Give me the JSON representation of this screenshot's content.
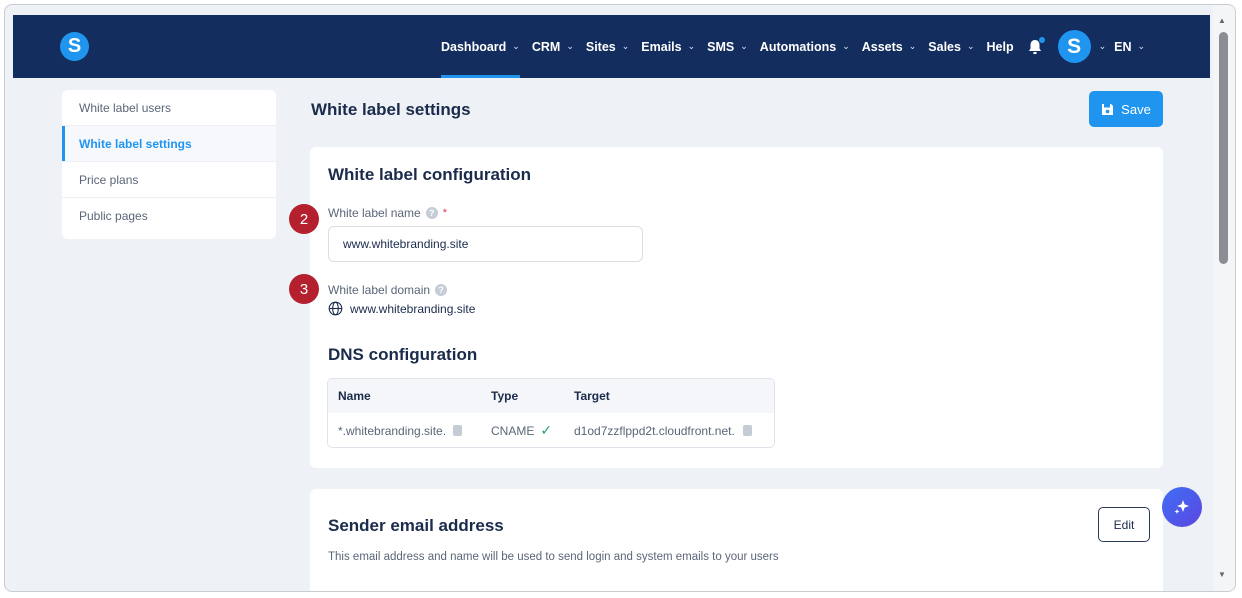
{
  "brand": {
    "logo_letter": "S"
  },
  "nav": {
    "items": [
      {
        "label": "Dashboard",
        "chevron": "⌄"
      },
      {
        "label": "CRM",
        "chevron": "⌄"
      },
      {
        "label": "Sites",
        "chevron": "⌄"
      },
      {
        "label": "Emails",
        "chevron": "⌄"
      },
      {
        "label": "SMS",
        "chevron": "⌄"
      },
      {
        "label": "Automations",
        "chevron": "⌄"
      },
      {
        "label": "Assets",
        "chevron": "⌄"
      },
      {
        "label": "Sales",
        "chevron": "⌄"
      },
      {
        "label": "Help",
        "chevron": ""
      }
    ],
    "avatar_letter": "S",
    "language": "EN"
  },
  "sidebar": {
    "items": [
      {
        "label": "White label users"
      },
      {
        "label": "White label settings"
      },
      {
        "label": "Price plans"
      },
      {
        "label": "Public pages"
      }
    ]
  },
  "page": {
    "title": "White label settings",
    "save_label": "Save"
  },
  "config": {
    "title": "White label configuration",
    "name_label": "White label name",
    "required_mark": "*",
    "name_value": "www.whitebranding.site",
    "domain_label": "White label domain",
    "domain_value": "www.whitebranding.site"
  },
  "dns": {
    "title": "DNS configuration",
    "headers": [
      "Name",
      "Type",
      "Target"
    ],
    "row": {
      "name": "*.whitebranding.site.",
      "type": "CNAME",
      "target": "d1od7zzflppd2t.cloudfront.net."
    }
  },
  "sender": {
    "title": "Sender email address",
    "edit_label": "Edit",
    "description": "This email address and name will be used to send login and system emails to your users"
  },
  "badges": [
    "2",
    "3"
  ],
  "help_glyph": "?",
  "colors": {
    "nav_bg": "#132d5e",
    "accent": "#1f95f0",
    "badge": "#b5202f",
    "success": "#22a06b"
  }
}
